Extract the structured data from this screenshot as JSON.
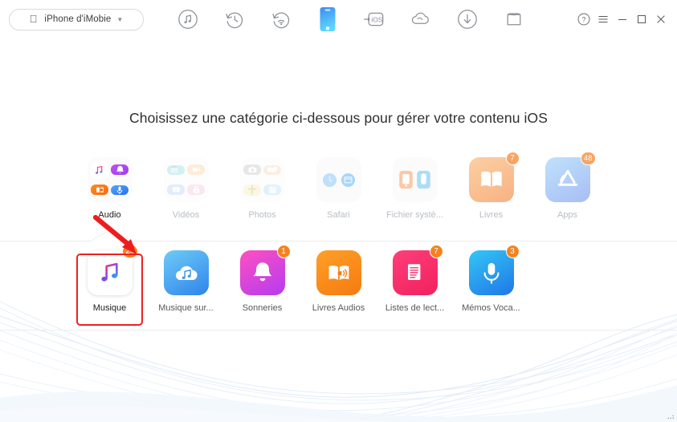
{
  "window": {
    "device_selector": {
      "label": "iPhone d'iMobie",
      "apple_icon": "apple-logo-icon",
      "caret_icon": "chevron-down-icon"
    },
    "toolbar": [
      {
        "name": "media-manager",
        "icon": "music-note-circle-icon",
        "active": false
      },
      {
        "name": "backup-restore",
        "icon": "clock-rewind-icon",
        "active": false
      },
      {
        "name": "airdrop-wireless",
        "icon": "wifi-rewind-icon",
        "active": false
      },
      {
        "name": "device-manager",
        "icon": "iphone-device-icon",
        "active": true
      },
      {
        "name": "ios-mover",
        "icon": "to-ios-icon",
        "active": false
      },
      {
        "name": "icloud-manager",
        "icon": "cloud-icon",
        "active": false
      },
      {
        "name": "downloader",
        "icon": "download-arrow-icon",
        "active": false
      },
      {
        "name": "toolkit",
        "icon": "tshirt-toolkit-icon",
        "active": false
      }
    ],
    "controls": [
      {
        "name": "help",
        "icon": "question-circle-icon",
        "label": "?"
      },
      {
        "name": "menu",
        "icon": "hamburger-menu-icon",
        "label": "☰"
      },
      {
        "name": "minimize",
        "icon": "minimize-icon",
        "label": "−"
      },
      {
        "name": "maximize",
        "icon": "maximize-icon",
        "label": "□"
      },
      {
        "name": "close",
        "icon": "close-icon",
        "label": "✕"
      }
    ]
  },
  "main": {
    "headline": "Choisissez une catégorie ci-dessous pour gérer votre contenu iOS",
    "row1": [
      {
        "label": "Audio",
        "icon": "audio-group-icon",
        "state": "active",
        "badge": null
      },
      {
        "label": "Vidéos",
        "icon": "videos-group-icon",
        "state": "dim",
        "badge": null
      },
      {
        "label": "Photos",
        "icon": "photos-group-icon",
        "state": "dim",
        "badge": null
      },
      {
        "label": "Safari",
        "icon": "safari-group-icon",
        "state": "dim",
        "badge": null
      },
      {
        "label": "Fichier systè...",
        "icon": "system-files-group-icon",
        "state": "dim",
        "badge": null
      },
      {
        "label": "Livres",
        "icon": "books-icon",
        "state": "dim",
        "badge": "7"
      },
      {
        "label": "Apps",
        "icon": "app-store-icon",
        "state": "dim",
        "badge": "48"
      }
    ],
    "row2": [
      {
        "label": "Musique",
        "icon": "music-note-icon",
        "state": "selected",
        "badge": "24"
      },
      {
        "label": "Musique sur...",
        "icon": "icloud-music-icon",
        "state": "normal",
        "badge": null
      },
      {
        "label": "Sonneries",
        "icon": "ringtone-bell-icon",
        "state": "normal",
        "badge": "1"
      },
      {
        "label": "Livres Audios",
        "icon": "audiobook-icon",
        "state": "normal",
        "badge": null
      },
      {
        "label": "Listes de lect...",
        "icon": "playlist-icon",
        "state": "normal",
        "badge": "7"
      },
      {
        "label": "Mémos Voca...",
        "icon": "voice-memo-mic-icon",
        "state": "normal",
        "badge": "3"
      }
    ],
    "annotation": {
      "arrow": "red-arrow-down",
      "highlight": "red-selection-box-musique"
    }
  },
  "colors": {
    "accent_blue": "#3fa2f7",
    "badge_orange": "#f5821f",
    "annotation_red": "#ef2020",
    "headline_text": "#2f2f2f",
    "caption_text": "#595959",
    "caption_dim": "#b9bec4"
  }
}
